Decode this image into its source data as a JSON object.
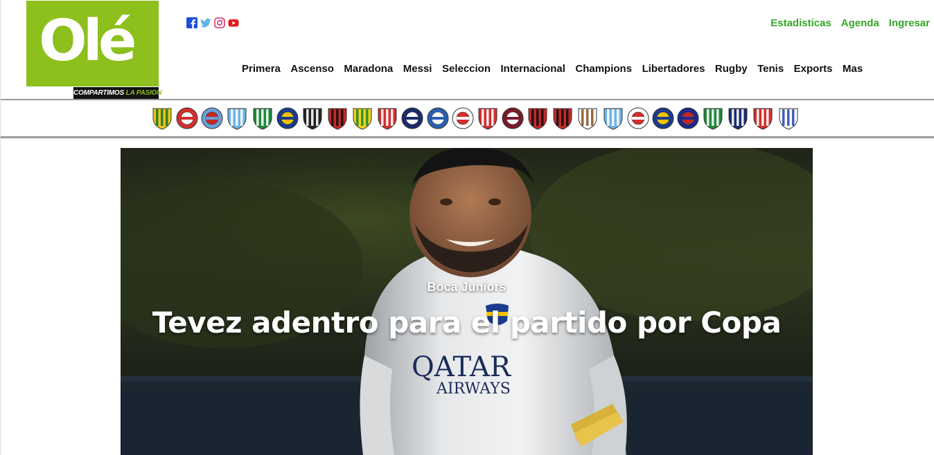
{
  "brand": {
    "logo_text": "Olé",
    "tagline_a": "COMPARTIMOS",
    "tagline_b": "LA PASION",
    "color": "#8dbf1d"
  },
  "social": [
    {
      "icon": "facebook-icon",
      "color": "#1d4ed8"
    },
    {
      "icon": "twitter-icon",
      "color": "#60b4e8"
    },
    {
      "icon": "instagram-icon",
      "color": "#d6336c"
    },
    {
      "icon": "youtube-icon",
      "color": "#e01b1b"
    }
  ],
  "top_links": [
    "Estadisticas",
    "Agenda",
    "Ingresar"
  ],
  "main_nav": [
    "Primera",
    "Ascenso",
    "Maradona",
    "Messi",
    "Seleccion",
    "Internacional",
    "Champions",
    "Libertadores",
    "Rugby",
    "Tenis",
    "Exports",
    "Mas"
  ],
  "crests": [
    {
      "name": "aldosivi-crest",
      "a": "#f0c419",
      "b": "#1a7a2a",
      "shape": "shield"
    },
    {
      "name": "argentinos-crest",
      "a": "#d32f2f",
      "b": "#ffffff",
      "shape": "circle"
    },
    {
      "name": "arsenal-crest",
      "a": "#6a9fd6",
      "b": "#c62828",
      "shape": "circle"
    },
    {
      "name": "atletico-tucuman-crest",
      "a": "#6bb3e8",
      "b": "#ffffff",
      "shape": "shield"
    },
    {
      "name": "banfield-crest",
      "a": "#1c8a3a",
      "b": "#ffffff",
      "shape": "shield"
    },
    {
      "name": "boca-crest",
      "a": "#1b3b8f",
      "b": "#f2c200",
      "shape": "circle"
    },
    {
      "name": "central-cordoba-crest",
      "a": "#222222",
      "b": "#ffffff",
      "shape": "shield"
    },
    {
      "name": "colon-crest",
      "a": "#c62828",
      "b": "#111111",
      "shape": "shield"
    },
    {
      "name": "defensa-crest",
      "a": "#f2d21b",
      "b": "#1f8a2e",
      "shape": "shield"
    },
    {
      "name": "estudiantes-crest",
      "a": "#d32f2f",
      "b": "#ffffff",
      "shape": "shield"
    },
    {
      "name": "gimnasia-crest",
      "a": "#1b2b6b",
      "b": "#ffffff",
      "shape": "circle"
    },
    {
      "name": "godoy-cruz-crest",
      "a": "#2b5fb0",
      "b": "#ffffff",
      "shape": "circle"
    },
    {
      "name": "huracan-crest",
      "a": "#ffffff",
      "b": "#d32f2f",
      "shape": "circle"
    },
    {
      "name": "independiente-crest",
      "a": "#d32f2f",
      "b": "#ffffff",
      "shape": "shield"
    },
    {
      "name": "lanus-crest",
      "a": "#7a1a2a",
      "b": "#ffffff",
      "shape": "circle"
    },
    {
      "name": "newells-crest",
      "a": "#c62828",
      "b": "#111111",
      "shape": "shield"
    },
    {
      "name": "patronato-crest",
      "a": "#c62828",
      "b": "#111111",
      "shape": "shield"
    },
    {
      "name": "platense-crest",
      "a": "#ffffff",
      "b": "#8b5a2b",
      "shape": "shield"
    },
    {
      "name": "racing-crest",
      "a": "#6bb3e8",
      "b": "#ffffff",
      "shape": "shield"
    },
    {
      "name": "river-crest",
      "a": "#ffffff",
      "b": "#d32f2f",
      "shape": "circle"
    },
    {
      "name": "rosario-central-crest",
      "a": "#1b3b8f",
      "b": "#f2c200",
      "shape": "circle"
    },
    {
      "name": "san-lorenzo-crest",
      "a": "#1b2b8f",
      "b": "#c62828",
      "shape": "circle"
    },
    {
      "name": "sarmiento-crest",
      "a": "#1c8a3a",
      "b": "#ffffff",
      "shape": "shield"
    },
    {
      "name": "talleres-crest",
      "a": "#1b2b6b",
      "b": "#ffffff",
      "shape": "shield"
    },
    {
      "name": "union-crest",
      "a": "#d32f2f",
      "b": "#ffffff",
      "shape": "shield"
    },
    {
      "name": "velez-crest",
      "a": "#ffffff",
      "b": "#2b4fb0",
      "shape": "shield"
    }
  ],
  "hero": {
    "kicker": "Boca Juniors",
    "title": "Tevez adentro para el partido por Copa",
    "jersey_sponsor": "QATAR",
    "jersey_sponsor_2": "AIRWAYS"
  }
}
